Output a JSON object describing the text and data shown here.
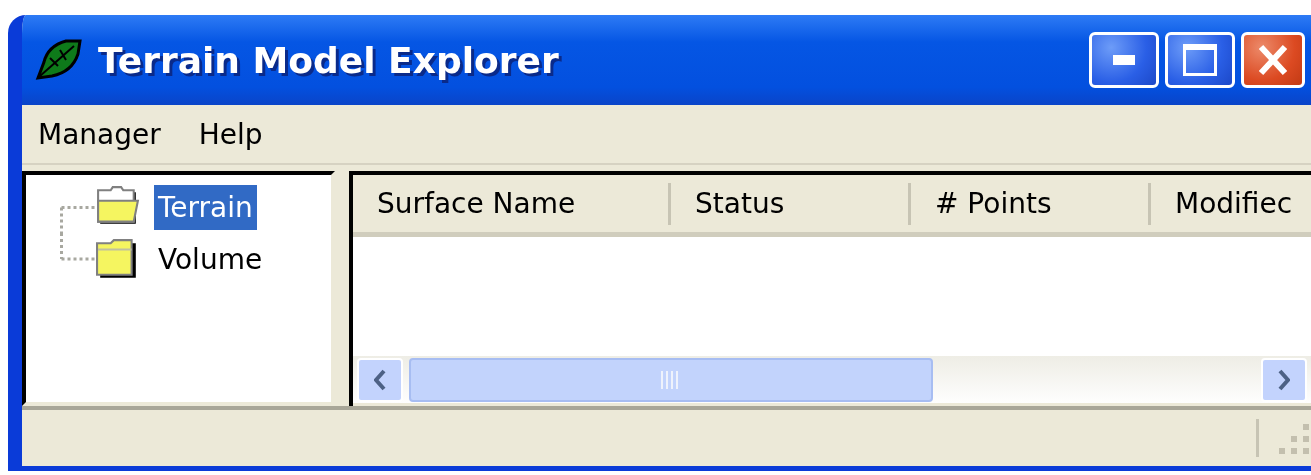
{
  "window": {
    "title": "Terrain Model Explorer"
  },
  "menu": [
    "Manager",
    "Help"
  ],
  "tree": {
    "items": [
      {
        "label": "Terrain",
        "selected": true
      },
      {
        "label": "Volume",
        "selected": false
      }
    ]
  },
  "table": {
    "columns": [
      "Surface Name",
      "Status",
      "# Points",
      "Modifiec"
    ]
  }
}
